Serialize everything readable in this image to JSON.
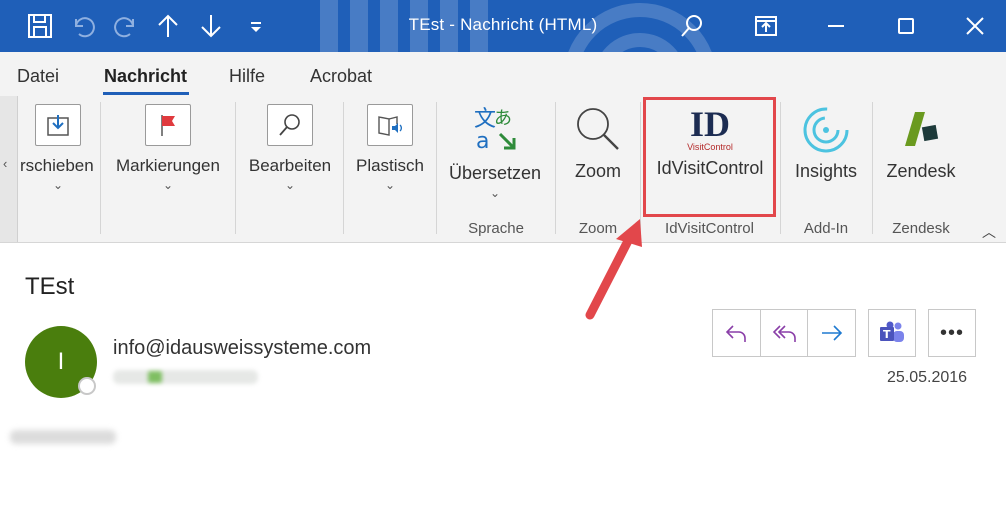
{
  "window": {
    "title": "TEst  -  Nachricht (HTML)"
  },
  "menu": {
    "items": [
      "Datei",
      "Nachricht",
      "Hilfe",
      "Acrobat"
    ],
    "active": "Nachricht"
  },
  "ribbon": {
    "buttons": {
      "verschieben": "rschieben",
      "markierungen": "Markierungen",
      "bearbeiten": "Bearbeiten",
      "plastisch": "Plastisch",
      "uebersetzen": "Übersetzen",
      "zoom": "Zoom",
      "idvisit": "IdVisitControl",
      "insights": "Insights",
      "zendesk": "Zendesk"
    },
    "groups": {
      "sprache": "Sprache",
      "zoom": "Zoom",
      "idvisit": "IdVisitControl",
      "addin": "Add-In",
      "zendesk": "Zendesk"
    },
    "idvisit_logo": {
      "big": "ID",
      "small": "VisitControl"
    }
  },
  "message": {
    "subject": "TEst",
    "sender_initial": "I",
    "sender": "info@idausweissysteme.com",
    "date": "25.05.2016"
  },
  "colors": {
    "titlebar": "#1f5fb8",
    "accent": "#1f5fb8",
    "avatar": "#4a7e0d",
    "highlight": "#e2474b",
    "reply_purple": "#8a3fa8",
    "forward_blue": "#1f7ad1"
  }
}
